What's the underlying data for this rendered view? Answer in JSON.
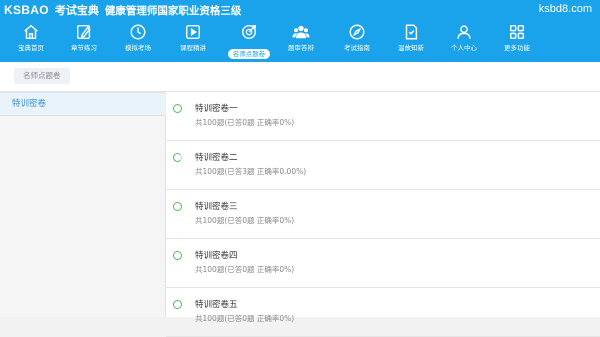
{
  "header": {
    "logo": "KSBAO",
    "logo_cn": "考试宝典",
    "app_title": "健康管理师国家职业资格三级",
    "site": "ksbd8.com"
  },
  "nav": [
    {
      "label": "宝典首页",
      "icon": "home-icon"
    },
    {
      "label": "章节练习",
      "icon": "edit-icon"
    },
    {
      "label": "模拟考场",
      "icon": "clock-icon"
    },
    {
      "label": "课程精讲",
      "icon": "video-icon"
    },
    {
      "label": "名师点题卷",
      "icon": "target-icon",
      "active": true
    },
    {
      "label": "题审答辩",
      "icon": "users-icon"
    },
    {
      "label": "考试指南",
      "icon": "compass-icon"
    },
    {
      "label": "温故知新",
      "icon": "notebook-icon"
    },
    {
      "label": "个人中心",
      "icon": "user-icon"
    },
    {
      "label": "更多功能",
      "icon": "grid-icon"
    }
  ],
  "sub_tab": "名师点题卷",
  "sidebar": {
    "items": [
      {
        "label": "特训密卷"
      }
    ]
  },
  "papers": [
    {
      "title": "特训密卷一",
      "summary": "共100题(已答0题 正确率0%)",
      "status": "none"
    },
    {
      "title": "特训密卷二",
      "summary": "共100题(已答3题 正确率0.00%)",
      "status": "partial"
    },
    {
      "title": "特训密卷三",
      "summary": "共100题(已答0题 正确率0%)",
      "status": "none"
    },
    {
      "title": "特训密卷四",
      "summary": "共100题(已答0题 正确率0%)",
      "status": "none"
    },
    {
      "title": "特训密卷五",
      "summary": "共100题(已答0题 正确率0%)",
      "status": "none"
    }
  ],
  "colors": {
    "accent": "#1aa3ea",
    "progress": "#5ab85a",
    "sidebar_active": "#3a8ed3"
  }
}
